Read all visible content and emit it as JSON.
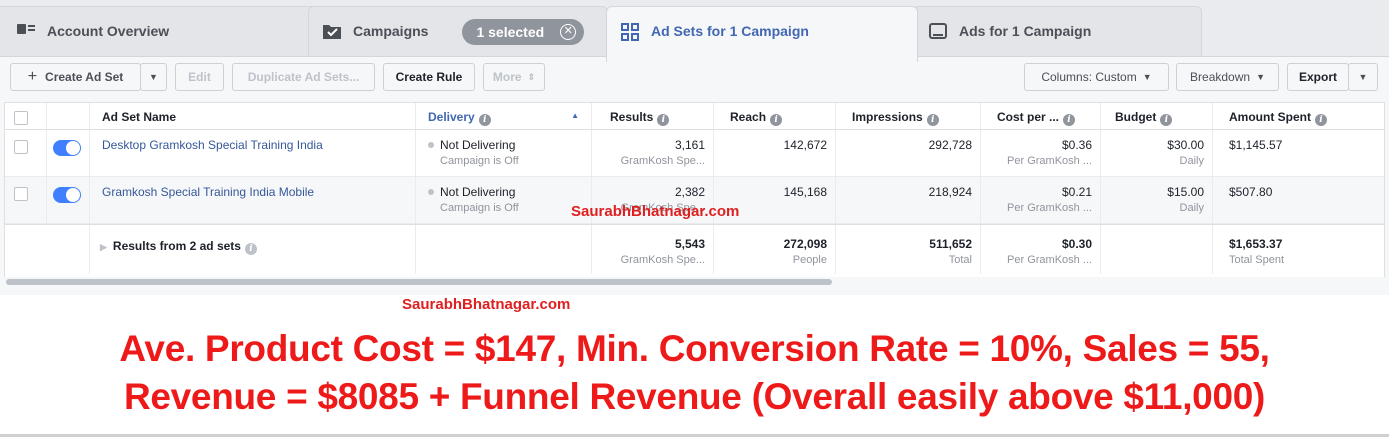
{
  "tabs": {
    "account": "Account Overview",
    "campaigns": "Campaigns",
    "selected": "1 selected",
    "adsets": "Ad Sets for 1 Campaign",
    "ads": "Ads for 1 Campaign"
  },
  "toolbar": {
    "create": "Create Ad Set",
    "edit": "Edit",
    "duplicate": "Duplicate Ad Sets...",
    "create_rule": "Create Rule",
    "more": "More",
    "columns": "Columns: Custom",
    "breakdown": "Breakdown",
    "export": "Export"
  },
  "table": {
    "headers": {
      "name": "Ad Set Name",
      "delivery": "Delivery",
      "results": "Results",
      "reach": "Reach",
      "impressions": "Impressions",
      "cost": "Cost per ...",
      "budget": "Budget",
      "spent": "Amount Spent"
    },
    "rows": [
      {
        "name": "Desktop Gramkosh Special Training India",
        "delivery": "Not Delivering",
        "delivery_sub": "Campaign is Off",
        "results": "3,161",
        "results_sub": "GramKosh Spe...",
        "reach": "142,672",
        "impressions": "292,728",
        "cost": "$0.36",
        "cost_sub": "Per GramKosh ...",
        "budget": "$30.00",
        "budget_sub": "Daily",
        "spent": "$1,145.57"
      },
      {
        "name": "Gramkosh Special Training India Mobile",
        "delivery": "Not Delivering",
        "delivery_sub": "Campaign is Off",
        "results": "2,382",
        "results_sub": "GramKosh Spe...",
        "reach": "145,168",
        "impressions": "218,924",
        "cost": "$0.21",
        "cost_sub": "Per GramKosh ...",
        "budget": "$15.00",
        "budget_sub": "Daily",
        "spent": "$507.80"
      }
    ],
    "summary": {
      "label": "Results from 2 ad sets",
      "results": "5,543",
      "results_sub": "GramKosh Spe...",
      "reach": "272,098",
      "reach_sub": "People",
      "impressions": "511,652",
      "impressions_sub": "Total",
      "cost": "$0.30",
      "cost_sub": "Per GramKosh ...",
      "spent": "$1,653.37",
      "spent_sub": "Total Spent"
    }
  },
  "watermark": "SaurabhBhatnagar.com",
  "caption": {
    "line1": "Ave. Product Cost = $147, Min. Conversion Rate = 10%, Sales = 55,",
    "line2": "Revenue = $8085 + Funnel Revenue (Overall easily above $11,000)"
  },
  "colors": {
    "accent": "#4267b2",
    "toggle": "#4080ff",
    "caption": "#ee1a1a"
  }
}
